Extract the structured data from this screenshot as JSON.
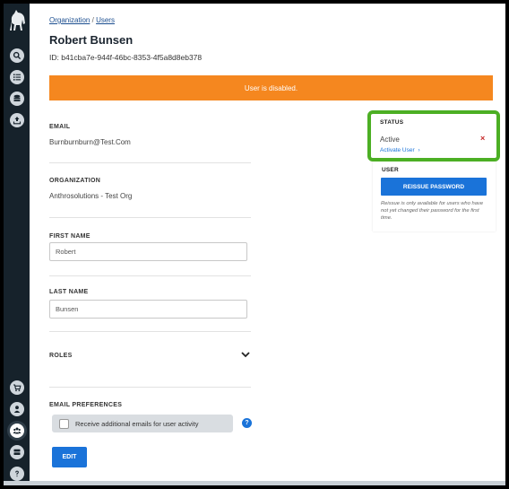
{
  "breadcrumb": {
    "org": "Organization",
    "sep": "/",
    "users": "Users"
  },
  "page": {
    "title": "Robert Bunsen",
    "user_id": "ID: b41cba7e-944f-46bc-8353-4f5a8d8eb378"
  },
  "banner": {
    "text": "User is disabled.",
    "color": "#f5871f"
  },
  "fields": {
    "email_label": "EMAIL",
    "email_value": "Burnburnburn@Test.Com",
    "org_label": "ORGANIZATION",
    "org_value": "Anthrosolutions - Test Org",
    "first_name_label": "FIRST NAME",
    "first_name_value": "Robert",
    "last_name_label": "LAST NAME",
    "last_name_value": "Bunsen",
    "roles_label": "ROLES",
    "email_pref_label": "EMAIL PREFERENCES",
    "email_pref_checkbox": "Receive additional emails for user activity",
    "help": "?"
  },
  "actions": {
    "edit": "EDIT"
  },
  "status_panel": {
    "status_label": "STATUS",
    "status_value": "Active",
    "activate_link": "Activate User",
    "activate_chevron": "›",
    "remove_mark": "×",
    "user_label": "USER",
    "reissue_button": "REISSUE PASSWORD",
    "reissue_note": "Reissue is only available for users who have not yet changed their password for the first time."
  },
  "sidebar": {
    "items": [
      "search-icon",
      "list-icon",
      "database-icon",
      "upload-icon",
      "cart-icon",
      "person-icon",
      "users-icon",
      "storage-icon",
      "help-icon"
    ],
    "active": "users-icon"
  },
  "colors": {
    "accent": "#1a73d9",
    "sidebar": "#16222b",
    "highlight": "#4caf24",
    "danger": "#c62828"
  }
}
